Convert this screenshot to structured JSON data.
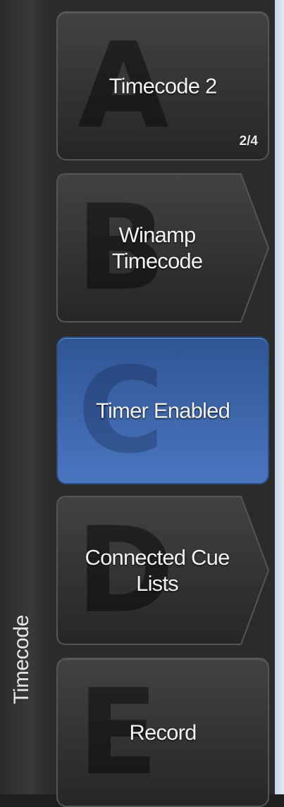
{
  "toolbar": {
    "title": "Timecode"
  },
  "softkeys": [
    {
      "letter": "A",
      "label": "Timecode 2",
      "page": "2/4",
      "style": "rounded"
    },
    {
      "letter": "B",
      "label": "Winamp\nTimecode",
      "style": "arrow"
    },
    {
      "letter": "C",
      "label": "Timer Enabled",
      "style": "active"
    },
    {
      "letter": "D",
      "label": "Connected Cue\nLists",
      "style": "arrow"
    },
    {
      "letter": "E",
      "label": "Record",
      "style": "rounded"
    }
  ],
  "colors": {
    "active_key": "#3d66ad",
    "key_background": "#333333",
    "sidebar_background": "#333333"
  }
}
